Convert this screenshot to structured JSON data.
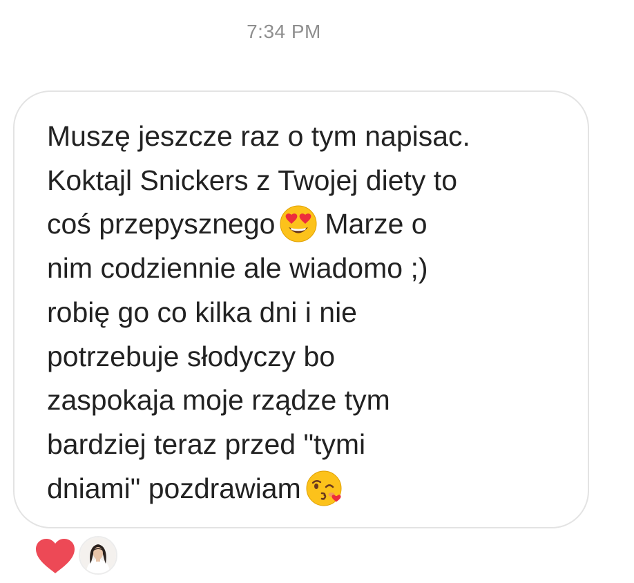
{
  "thread": {
    "timestamp": "7:34 PM"
  },
  "message": {
    "lines": [
      {
        "text": "Muszę jeszcze raz o tym napisac."
      },
      {
        "text": "Koktajl Snickers z Twojej diety to"
      },
      {
        "before": "coś przepysznego",
        "emoji": "heart-eyes-emoji",
        "after": "Marze o"
      },
      {
        "text": "nim codziennie ale wiadomo ;)"
      },
      {
        "text": "robię go co kilka dni i nie"
      },
      {
        "text": "potrzebuje słodyczy bo"
      },
      {
        "text": "zaspokaja moje rządze tym"
      },
      {
        "text": "bardziej teraz przed \"tymi"
      },
      {
        "before": "dniami\" pozdrawiam",
        "emoji": "kissing-heart-emoji"
      }
    ]
  },
  "reactions": {
    "heart": {
      "icon": "heart-icon",
      "color": "#ed4956"
    },
    "avatar": {
      "icon": "profile-avatar"
    }
  },
  "colors": {
    "text": "#222222",
    "timestamp": "#8e8e8e",
    "bubble_border": "#e3e3e3",
    "heart": "#ed4956",
    "emoji_face": "#fcc21b"
  }
}
